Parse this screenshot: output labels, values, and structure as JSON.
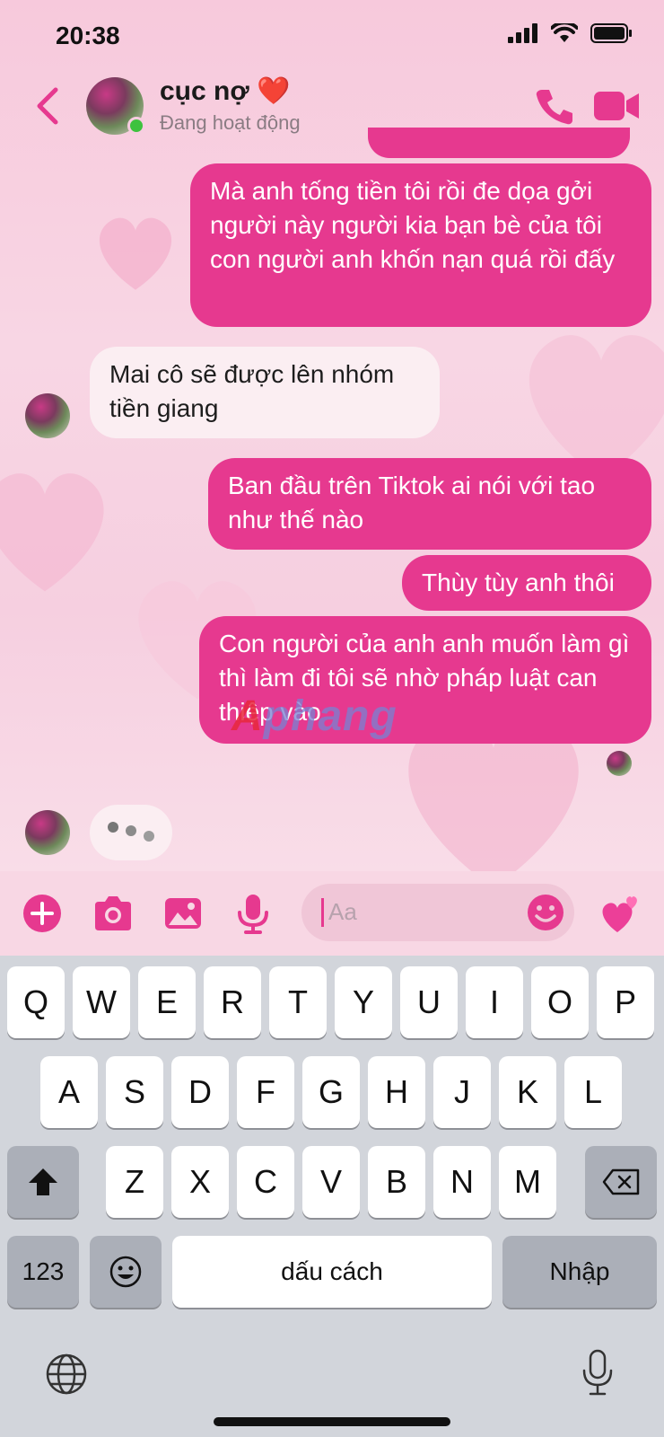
{
  "status_bar": {
    "time": "20:38"
  },
  "header": {
    "contact_name": "cục nợ ❤️",
    "contact_status": "Đang hoạt động"
  },
  "messages": [
    {
      "sender": "me",
      "text": "Mà anh tống tiền tôi rồi đe dọa gởi người này người kia bạn bè của tôi con người anh khốn nạn quá rồi đấy"
    },
    {
      "sender": "them",
      "text": "Mai cô sẽ được lên nhóm tiền giang"
    },
    {
      "sender": "me",
      "text": "Ban đầu trên Tiktok ai nói với tao như thế nào"
    },
    {
      "sender": "me",
      "text": "Thùy tùy anh thôi"
    },
    {
      "sender": "me",
      "text": "Con người của anh anh muốn làm gì thì làm đi tôi sẽ nhờ pháp luật can thiệp vào"
    }
  ],
  "watermark": {
    "lead": "A",
    "rest": "phang"
  },
  "composer": {
    "placeholder": "Aa"
  },
  "keyboard": {
    "row1": [
      "Q",
      "W",
      "E",
      "R",
      "T",
      "Y",
      "U",
      "I",
      "O",
      "P"
    ],
    "row2": [
      "A",
      "S",
      "D",
      "F",
      "G",
      "H",
      "J",
      "K",
      "L"
    ],
    "row3": [
      "Z",
      "X",
      "C",
      "V",
      "B",
      "N",
      "M"
    ],
    "numbers_label": "123",
    "space_label": "dấu cách",
    "return_label": "Nhập"
  },
  "colors": {
    "accent": "#e6398f",
    "received_bubble": "#fbeef2",
    "online": "#3ec23e"
  },
  "icons": [
    "signal-icon",
    "wifi-icon",
    "battery-icon",
    "back-icon",
    "phone-icon",
    "video-icon",
    "plus-icon",
    "camera-icon",
    "image-icon",
    "mic-icon",
    "emoji-icon",
    "heart-emoji-icon",
    "shift-icon",
    "backspace-icon",
    "globe-icon",
    "dictation-icon"
  ]
}
